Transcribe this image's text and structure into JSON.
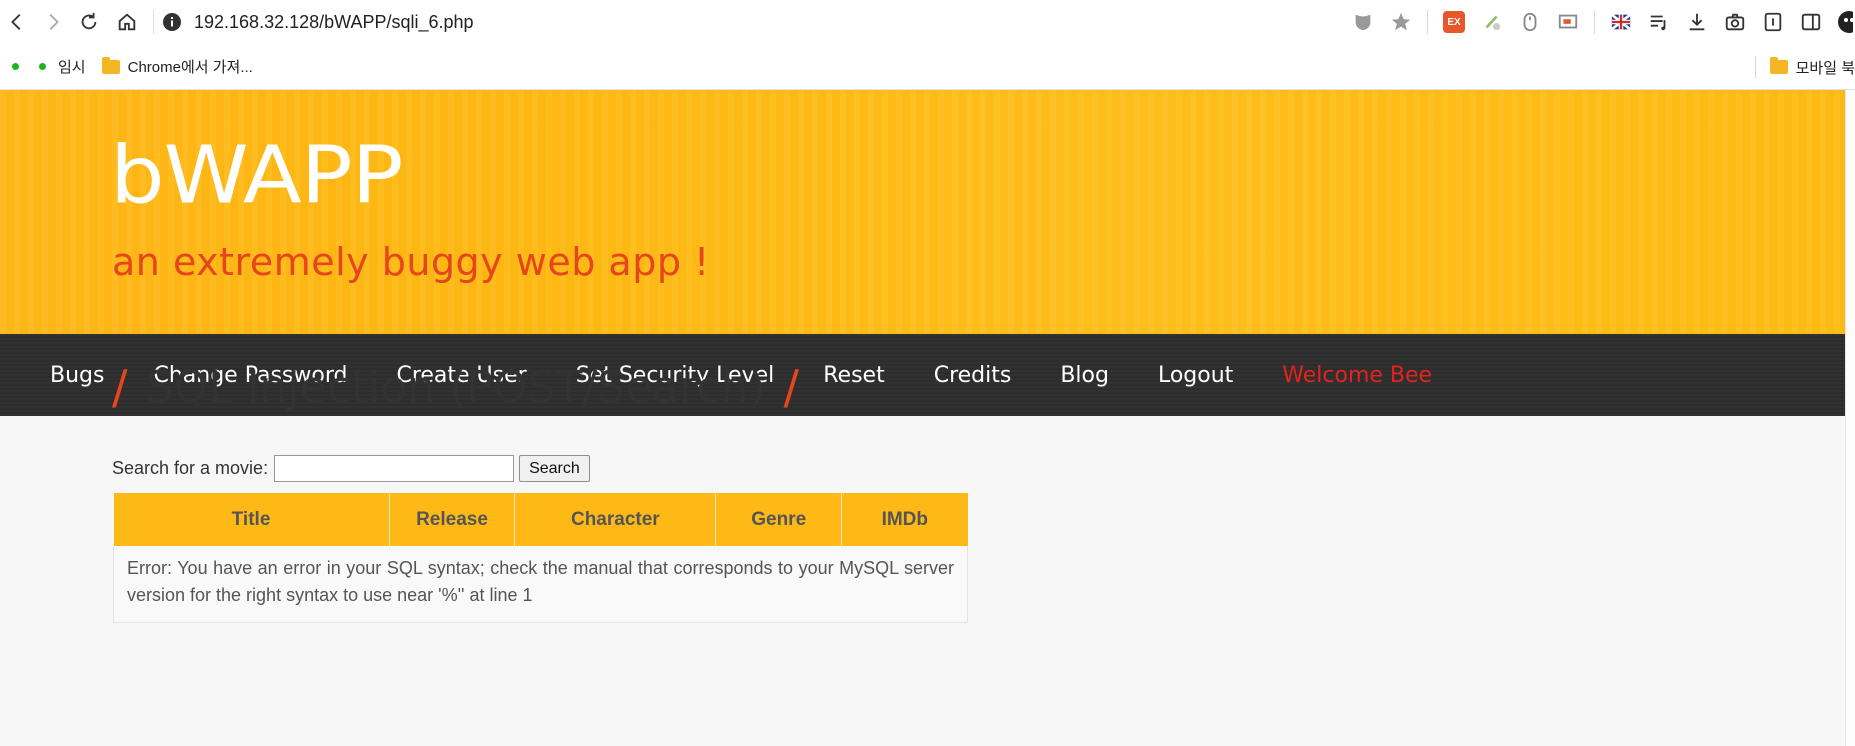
{
  "browser": {
    "url": "192.168.32.128/bWAPP/sqli_6.php",
    "bookmarks": [
      {
        "label": "임시"
      },
      {
        "label": "Chrome에서 가져..."
      }
    ],
    "bookmarks_right": "모바일 북",
    "ext_badge": "EX"
  },
  "header": {
    "logo": "bWAPP",
    "tagline": "an extremely buggy web app !"
  },
  "menu": [
    {
      "label": "Bugs"
    },
    {
      "label": "Change Password"
    },
    {
      "label": "Create User"
    },
    {
      "label": "Set Security Level"
    },
    {
      "label": "Reset"
    },
    {
      "label": "Credits"
    },
    {
      "label": "Blog"
    },
    {
      "label": "Logout"
    }
  ],
  "welcome": "Welcome Bee",
  "page": {
    "slash": "/",
    "title": "SQL Injection (POST/Search)",
    "search_label": "Search for a movie:",
    "search_value": "",
    "search_button": "Search"
  },
  "table": {
    "columns": [
      "Title",
      "Release",
      "Character",
      "Genre",
      "IMDb"
    ],
    "error": "Error: You have an error in your SQL syntax; check the manual that corresponds to your MySQL server version for the right syntax to use near '%'' at line 1"
  },
  "colors": {
    "header": "#ffba14",
    "tagline": "#e6461b",
    "menu_bg": "#2e2e2e",
    "welcome": "#e3231d",
    "table_header": "#ffb917"
  }
}
